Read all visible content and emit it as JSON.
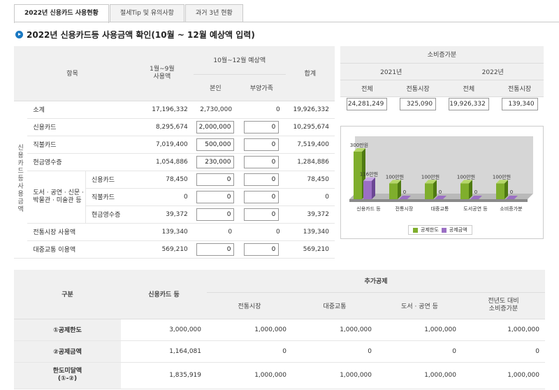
{
  "tabs": [
    "2022년 신용카드 사용현황",
    "절세Tip 및 유의사항",
    "과거 3년 현황"
  ],
  "section_title": "2022년 신용카드등 사용금액 확인(10월 ~ 12월 예상액 입력)",
  "main": {
    "headers": {
      "item": "항목",
      "jan_sep": "1월~9월\n사용액",
      "oct_dec": "10월~12월 예상액",
      "self": "본인",
      "dependents": "부양가족",
      "total": "합계"
    },
    "side_label": "신용카드등 사용금액",
    "subtotal": {
      "label": "소계",
      "jan_sep": "17,196,332",
      "self": "2,730,000",
      "dependents": "0",
      "total": "19,926,332"
    },
    "rows": [
      {
        "label": "신용카드",
        "jan_sep": "8,295,674",
        "self": "2,000,000",
        "dependents": "0",
        "total": "10,295,674"
      },
      {
        "label": "직불카드",
        "jan_sep": "7,019,400",
        "self": "500,000",
        "dependents": "0",
        "total": "7,519,400"
      },
      {
        "label": "현금영수증",
        "jan_sep": "1,054,886",
        "self": "230,000",
        "dependents": "0",
        "total": "1,284,886"
      }
    ],
    "culture_label": "도서 · 공연 · 신문 · 박물관 · 미술관 등",
    "culture_rows": [
      {
        "label": "신용카드",
        "jan_sep": "78,450",
        "self": "0",
        "dependents": "0",
        "total": "78,450"
      },
      {
        "label": "직불카드",
        "jan_sep": "0",
        "self": "0",
        "dependents": "0",
        "total": "0"
      },
      {
        "label": "현금영수증",
        "jan_sep": "39,372",
        "self": "0",
        "dependents": "0",
        "total": "39,372"
      }
    ],
    "market": {
      "label": "전통시장 사용액",
      "jan_sep": "139,340",
      "self": "0",
      "dependents": "0",
      "total": "139,340"
    },
    "transit": {
      "label": "대중교통 이용액",
      "jan_sep": "569,210",
      "self": "0",
      "dependents": "0",
      "total": "569,210"
    }
  },
  "increase": {
    "title": "소비증가분",
    "year1": "2021년",
    "year2": "2022년",
    "col_total": "전체",
    "col_market": "전통시장",
    "v2021_total": "24,281,249",
    "v2021_market": "325,090",
    "v2022_total": "19,926,332",
    "v2022_market": "139,340"
  },
  "chart_data": {
    "type": "bar",
    "categories": [
      "신용카드 등",
      "전통시장",
      "대중교통",
      "도서공연 등",
      "소비증가분"
    ],
    "series": [
      {
        "name": "공제한도",
        "values": [
          300,
          100,
          100,
          100,
          100
        ],
        "color": "#7fae2c"
      },
      {
        "name": "공제금액",
        "values": [
          116,
          0,
          0,
          0,
          0
        ],
        "color": "#9b6fc4"
      }
    ],
    "labels_limit": [
      "300만원",
      "100만원",
      "100만원",
      "100만원",
      "100만원"
    ],
    "labels_amount": [
      "116만원",
      "0",
      "0",
      "0",
      "0"
    ],
    "ylim": [
      0,
      300
    ]
  },
  "bottom": {
    "headers": {
      "category": "구분",
      "card": "신용카드 등",
      "extra": "추가공제",
      "market": "전통시장",
      "transit": "대중교통",
      "culture": "도서 · 공연 등",
      "increase": "전년도 대비\n소비증가분"
    },
    "rows": [
      {
        "label": "①공제한도",
        "card": "3,000,000",
        "market": "1,000,000",
        "transit": "1,000,000",
        "culture": "1,000,000",
        "increase": "1,000,000"
      },
      {
        "label": "②공제금액",
        "card": "1,164,081",
        "market": "0",
        "transit": "0",
        "culture": "0",
        "increase": "0"
      },
      {
        "label": "한도미달액\n(①-②)",
        "card": "1,835,919",
        "market": "1,000,000",
        "transit": "1,000,000",
        "culture": "1,000,000",
        "increase": "1,000,000"
      }
    ]
  }
}
